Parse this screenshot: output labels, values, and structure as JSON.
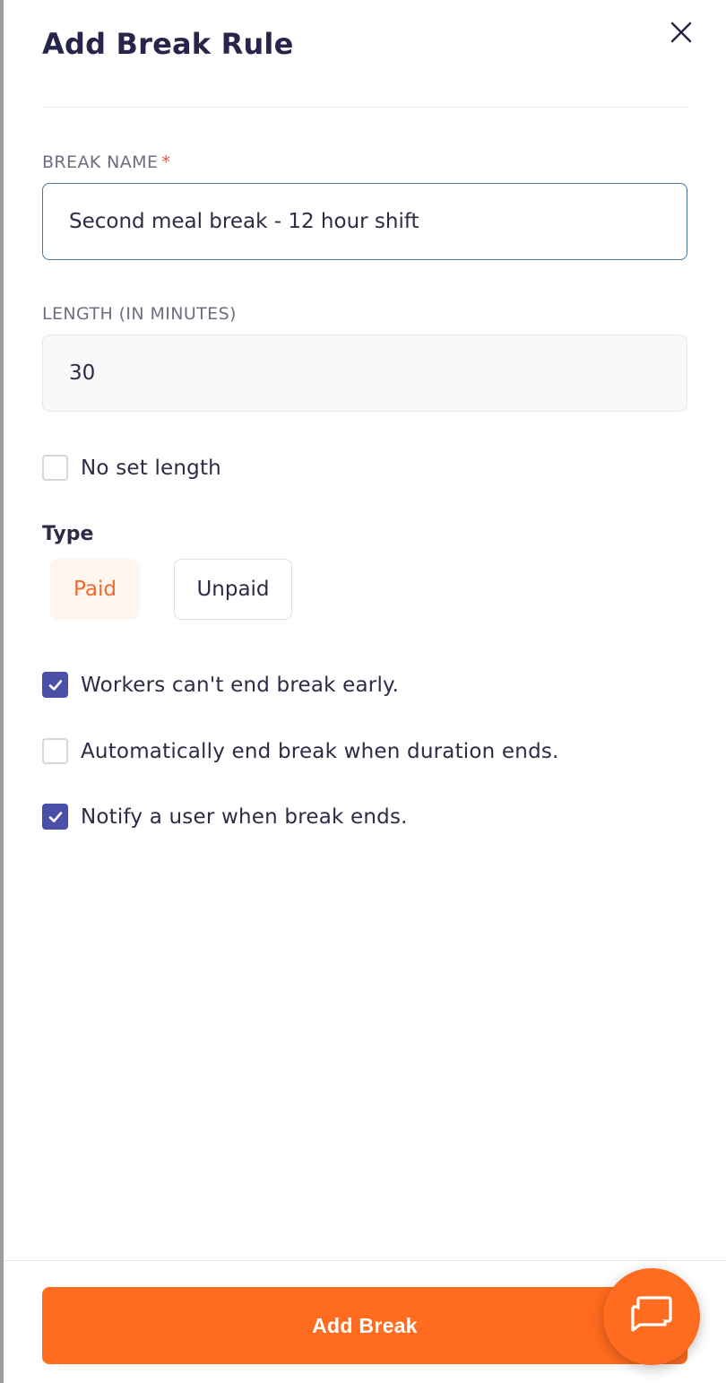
{
  "header": {
    "title": "Add Break Rule",
    "close_icon": "close-icon"
  },
  "form": {
    "break_name": {
      "label": "BREAK NAME",
      "required_marker": "*",
      "value": "Second meal break - 12 hour shift"
    },
    "length": {
      "label": "LENGTH (IN MINUTES)",
      "value": "30"
    },
    "no_set_length": {
      "label": "No set length",
      "checked": false
    },
    "type": {
      "label": "Type",
      "options": [
        "Paid",
        "Unpaid"
      ],
      "selected": "Paid"
    },
    "options": [
      {
        "label": "Workers can't end break early.",
        "checked": true
      },
      {
        "label": "Automatically end break when duration ends.",
        "checked": false
      },
      {
        "label": "Notify a user when break ends.",
        "checked": true
      }
    ]
  },
  "footer": {
    "submit_label": "Add Break",
    "chat_icon": "chat-icon"
  },
  "colors": {
    "accent": "#ff6b1f",
    "checkbox_checked": "#4a4fa8",
    "input_focus_border": "#4478a6",
    "required": "#e5533d",
    "heading": "#27264a"
  }
}
